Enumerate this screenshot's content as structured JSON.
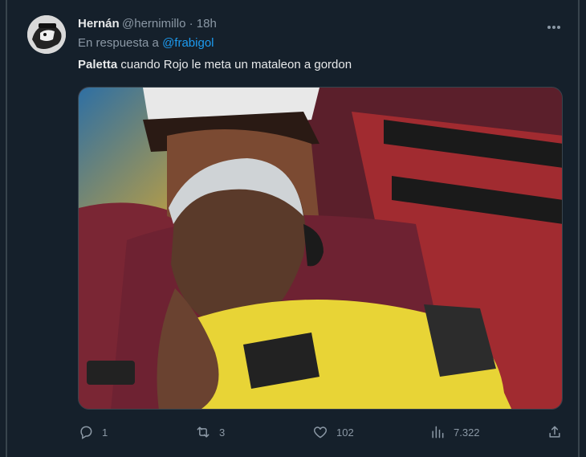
{
  "tweet": {
    "author_name": "Hernán",
    "author_handle": "@hernimillo",
    "separator": "·",
    "time": "18h",
    "reply_prefix": "En respuesta a",
    "reply_to": "@frabigol",
    "text_bold": "Paletta",
    "text_rest": " cuando Rojo le meta un mataleon a gordon"
  },
  "actions": {
    "replies": "1",
    "retweets": "3",
    "likes": "102",
    "views": "7.322"
  },
  "icons": {
    "more": "more-horizontal-icon",
    "reply": "reply-icon",
    "retweet": "retweet-icon",
    "like": "heart-icon",
    "views": "views-icon",
    "share": "share-icon"
  },
  "colors": {
    "background": "#15202b",
    "text": "#e7e9ea",
    "muted": "#8b98a5",
    "link": "#1d9bf0"
  }
}
